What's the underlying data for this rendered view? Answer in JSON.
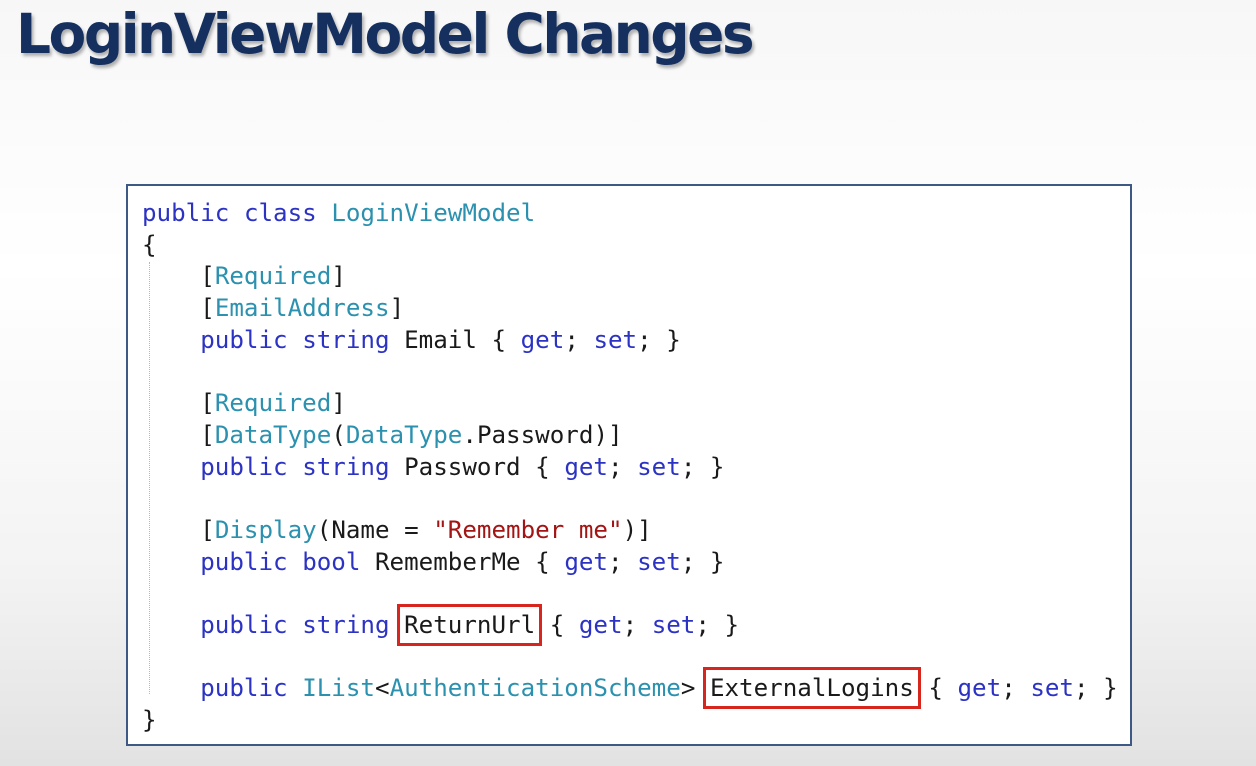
{
  "slide": {
    "title": "LoginViewModel Changes"
  },
  "code": {
    "l1": [
      "public",
      "class",
      "LoginViewModel"
    ],
    "open_brace": "{",
    "l3": [
      "Required"
    ],
    "l4": [
      "EmailAddress"
    ],
    "l5": [
      "public",
      "string",
      "Email",
      "get",
      "set"
    ],
    "l7": [
      "Required"
    ],
    "l8": [
      "DataType",
      "DataType",
      "Password"
    ],
    "l9": [
      "public",
      "string",
      "Password",
      "get",
      "set"
    ],
    "l11": [
      "Display",
      "Name",
      "\"Remember me\""
    ],
    "l12": [
      "public",
      "bool",
      "RememberMe",
      "get",
      "set"
    ],
    "l14": [
      "public",
      "string",
      "ReturnUrl",
      "get",
      "set"
    ],
    "l16": [
      "public",
      "IList",
      "AuthenticationScheme",
      "ExternalLogins",
      "get",
      "set"
    ],
    "close_brace": "}"
  },
  "colors": {
    "title": "#15305f",
    "keyword": "#2c33c4",
    "type": "#2b91af",
    "string": "#a31515",
    "highlight_box": "#d7261e",
    "code_border": "#3d5a86"
  }
}
